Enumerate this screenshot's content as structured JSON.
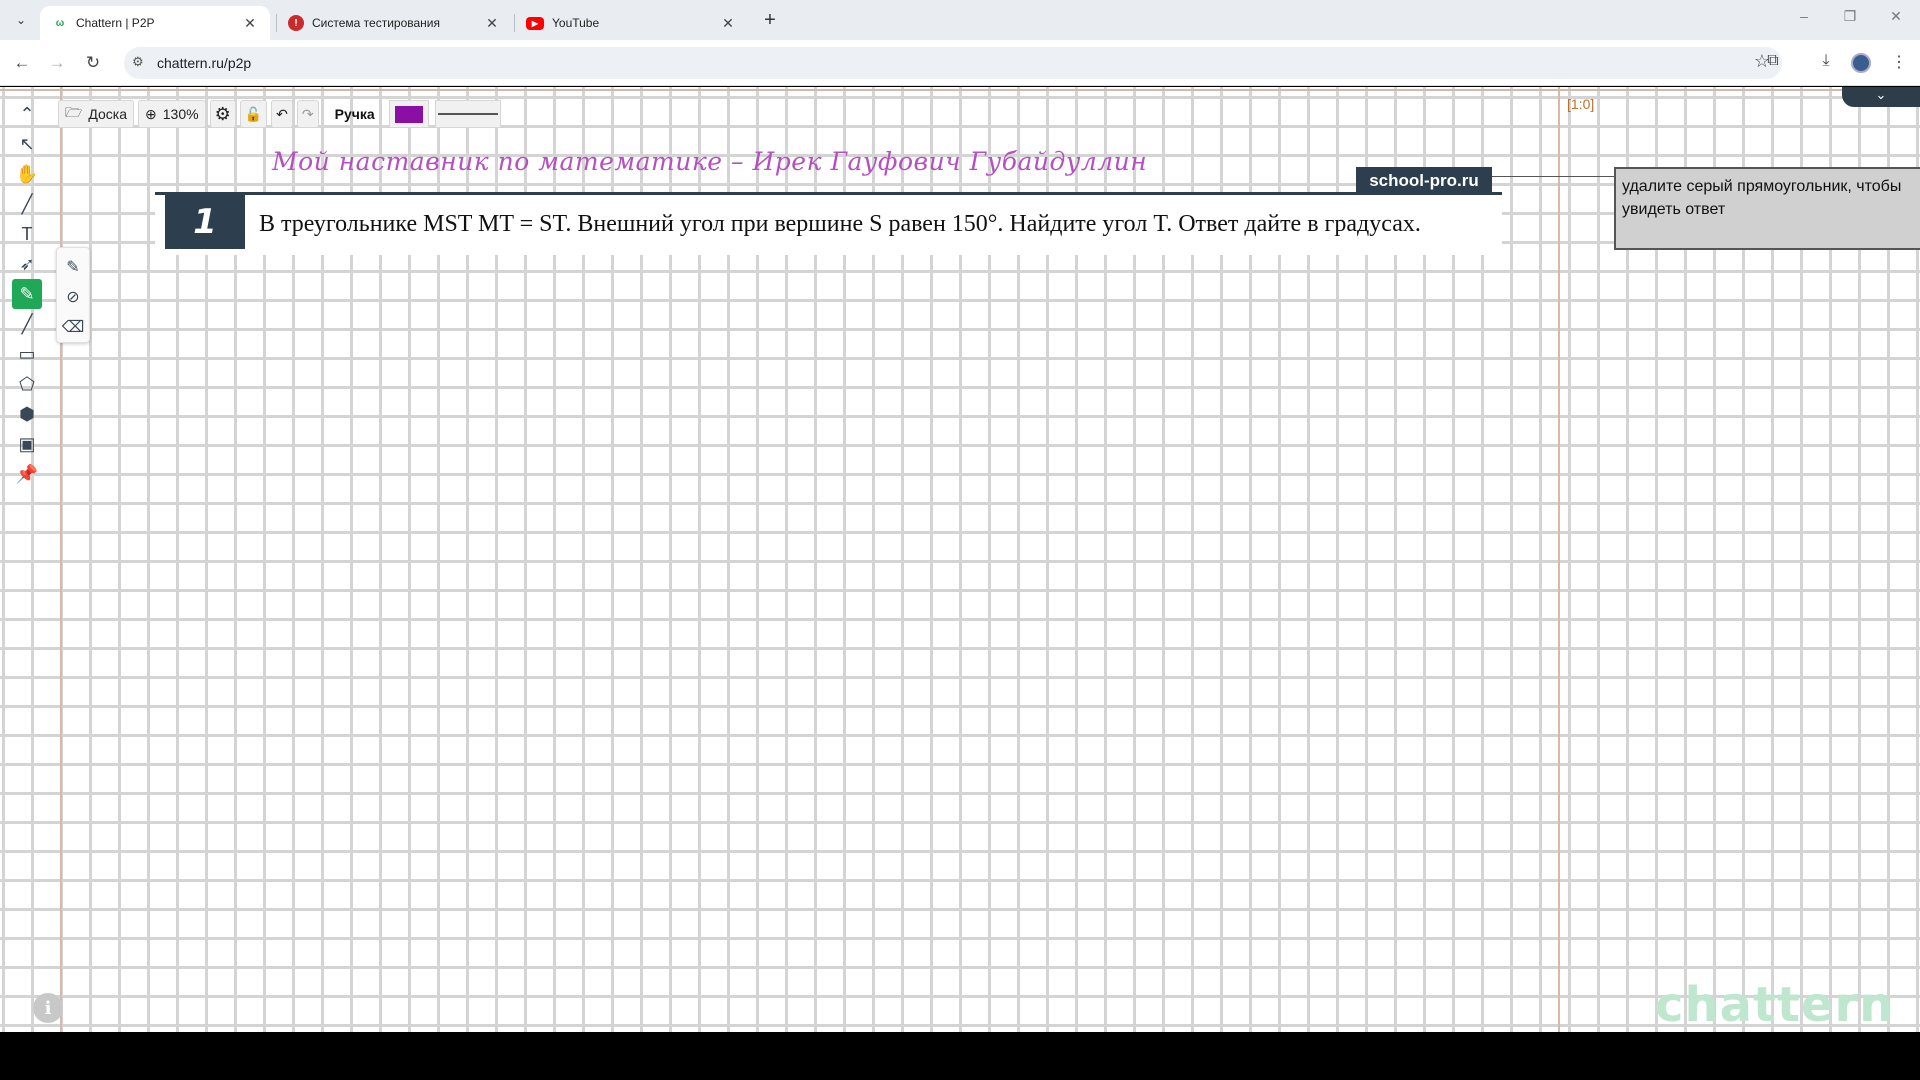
{
  "browser": {
    "tabs": [
      {
        "title": "Chattern | P2P",
        "favicon": "chattern-icon",
        "active": true
      },
      {
        "title": "Система тестирования",
        "favicon": "red-info-icon",
        "active": false
      },
      {
        "title": "YouTube",
        "favicon": "youtube-icon",
        "active": false
      }
    ],
    "url": "chattern.ru/p2p",
    "window_controls": {
      "minimize": "–",
      "restore": "❐",
      "close": "✕"
    }
  },
  "board": {
    "coord": "[1:0]",
    "toolbar": {
      "board_label": "Доска",
      "zoom": "130%",
      "tool_label": "Ручка",
      "pen_color": "#8a0fa5"
    },
    "handwriting": "Мой наставник по математике – Ирек Гауфович Губайдуллин",
    "task": {
      "number": "1",
      "text": "В треугольнике MST MT = ST. Внешний угол при вершине S равен 150°. Найдите угол T. Ответ дайте в градусах."
    },
    "brand_tag": "school-pro.ru",
    "answer_hint": "удалите серый прямоугольник, чтобы увидеть ответ",
    "watermark": "chattern"
  }
}
